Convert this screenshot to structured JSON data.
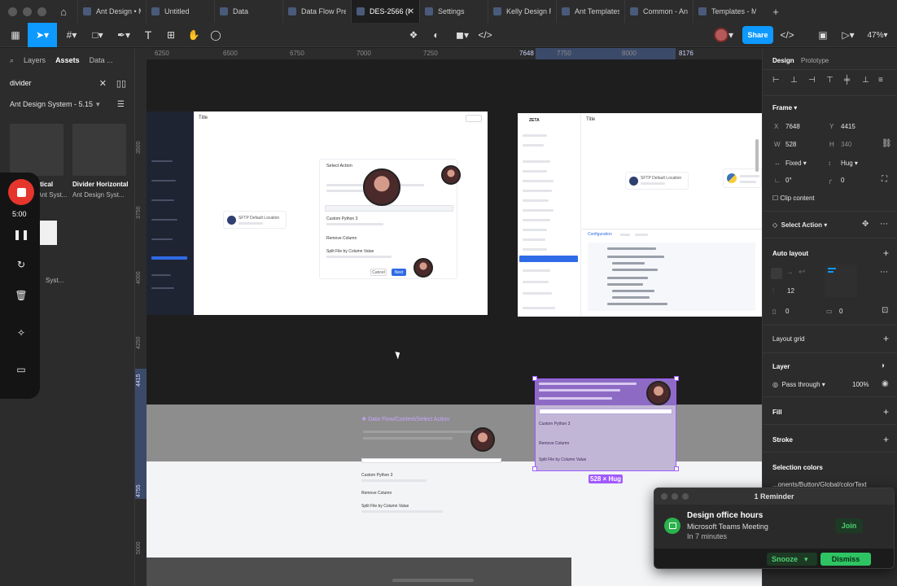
{
  "tabs": [
    {
      "label": "Ant Design • M"
    },
    {
      "label": "Untitled"
    },
    {
      "label": "Data"
    },
    {
      "label": "Data Flow Previ"
    },
    {
      "label": "DES-2566 (I"
    },
    {
      "label": "Settings"
    },
    {
      "label": "Kelly Design Re"
    },
    {
      "label": "Ant Templates"
    },
    {
      "label": "Common - Ant"
    },
    {
      "label": "Templates - Mo"
    }
  ],
  "toolbar": {
    "share_label": "Share",
    "zoom": "47%"
  },
  "left_panel": {
    "tab_layers": "Layers",
    "tab_assets": "Assets",
    "tab_data": "Data ...",
    "search_value": "divider",
    "library_name": "Ant Design System - 5.15",
    "asset1_title": "rtical",
    "asset1_sub": "Ant Syst...",
    "asset2_title": "Divider Horizontal",
    "asset2_sub": "Ant Design Syst...",
    "asset3_sub": "Syst..."
  },
  "recording": {
    "time": "5:00"
  },
  "ruler": {
    "top": [
      "6250",
      "6500",
      "6750",
      "7000",
      "7250",
      "7648",
      "7750",
      "8000",
      "8176"
    ],
    "left": [
      "3500",
      "3750",
      "4000",
      "4250",
      "4415",
      "4755",
      "5000"
    ]
  },
  "canvas": {
    "frame1_title": "Title",
    "frame1_action": "Select Action",
    "frame1_item1": "Custom Python 3",
    "frame1_item2": "Remove Column",
    "frame1_item3": "Split File by Column Value",
    "frame1_cancel": "Cancel",
    "frame1_next": "Next",
    "frame1_node": "SFTP Default Location",
    "frame2_logo": "ZETA",
    "frame2_title": "Title",
    "frame2_node": "SFTP Default Location",
    "frame2_tab": "Configuration",
    "band_title": "Data Flow/Context/Select Action",
    "section_item1": "Custom Python 3",
    "section_item2": "Remove Column",
    "section_item3": "Split File by Column Value",
    "size_badge": "528 × Hug"
  },
  "right_panel": {
    "tab_design": "Design",
    "tab_prototype": "Prototype",
    "frame_label": "Frame",
    "x_label": "X",
    "x_value": "7648",
    "y_label": "Y",
    "y_value": "4415",
    "w_label": "W",
    "w_value": "528",
    "h_label": "H",
    "h_value": "340",
    "width_mode": "Fixed",
    "height_mode": "Hug",
    "rotation": "0°",
    "radius": "0",
    "clip_content": "Clip content",
    "component_name": "Select Action",
    "auto_layout": "Auto layout",
    "gap": "12",
    "pad_h": "0",
    "pad_v": "0",
    "layout_grid": "Layout grid",
    "layer": "Layer",
    "blend": "Pass through",
    "opacity": "100%",
    "fill": "Fill",
    "stroke": "Stroke",
    "selection_colors": "Selection colors",
    "color_token": "...onents/Button/Global/colorText"
  },
  "notification": {
    "header": "1 Reminder",
    "title": "Design office hours",
    "subtitle": "Microsoft Teams Meeting",
    "time": "In 7 minutes",
    "join": "Join",
    "snooze": "Snooze",
    "dismiss": "Dismiss"
  }
}
